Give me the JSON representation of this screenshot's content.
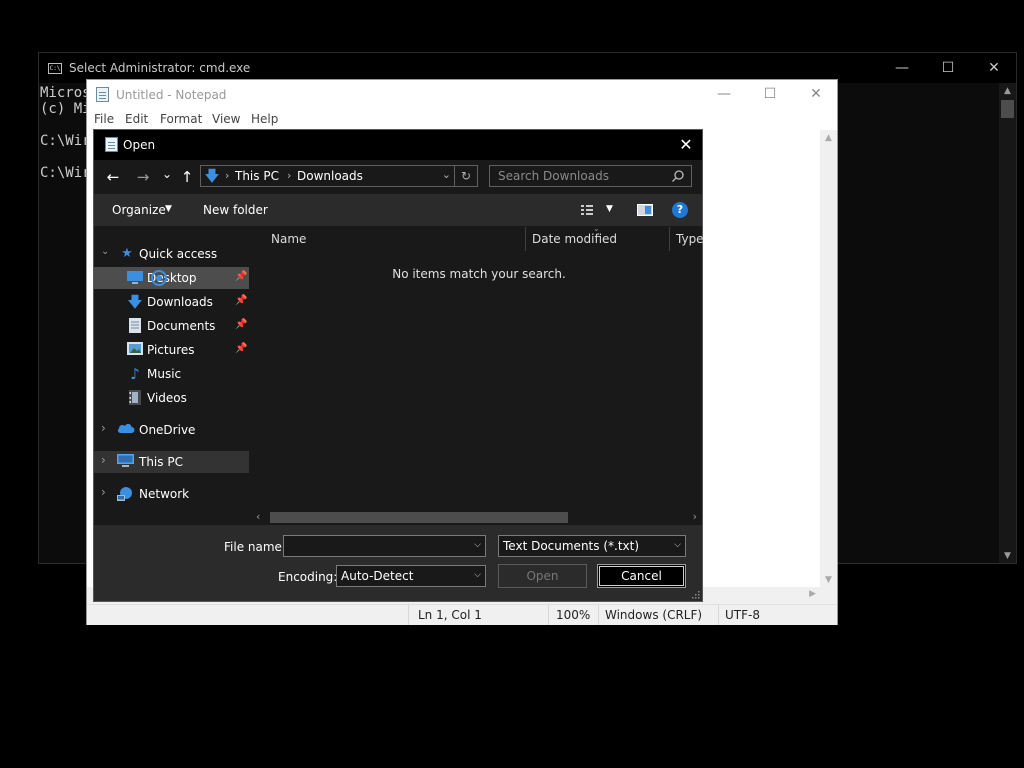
{
  "cmd": {
    "title": "Select Administrator: cmd.exe",
    "icon_text": "C:\\",
    "output": "Micros\n(c) Mi\n\nC:\\Wir\n\nC:\\Wir",
    "controls": {
      "minimize": "—",
      "maximize": "☐",
      "close": "✕"
    }
  },
  "notepad": {
    "title": "Untitled - Notepad",
    "menu": {
      "file": "File",
      "edit": "Edit",
      "format": "Format",
      "view": "View",
      "help": "Help"
    },
    "controls": {
      "minimize": "—",
      "maximize": "☐",
      "close": "✕"
    },
    "status": {
      "position": "Ln 1, Col 1",
      "zoom": "100%",
      "line_ending": "Windows (CRLF)",
      "encoding": "UTF-8"
    }
  },
  "dialog": {
    "title": "Open",
    "close": "✕",
    "nav": {
      "back": "←",
      "forward": "→",
      "recent": "⌄",
      "up": "↑"
    },
    "breadcrumb": {
      "root": "This PC",
      "current": "Downloads"
    },
    "search_placeholder": "Search Downloads",
    "toolbar": {
      "organize": "Organize",
      "new_folder": "New folder",
      "help": "?"
    },
    "tree": {
      "quick_access": "Quick access",
      "desktop": "Desktop",
      "downloads": "Downloads",
      "documents": "Documents",
      "pictures": "Pictures",
      "music": "Music",
      "videos": "Videos",
      "onedrive": "OneDrive",
      "this_pc": "This PC",
      "network": "Network"
    },
    "columns": {
      "name": "Name",
      "date_modified": "Date modified",
      "type": "Type"
    },
    "empty_message": "No items match your search.",
    "file_name_label": "File name:",
    "file_name_value": "",
    "file_type": "Text Documents (*.txt)",
    "encoding_label": "Encoding:",
    "encoding_value": "Auto-Detect",
    "open_button": "Open",
    "cancel_button": "Cancel"
  },
  "colors": {
    "accent": "#3a8fe0",
    "dialog_bg": "#2b2b2b",
    "pane_bg": "#191919",
    "selected": "#4d4d4d"
  }
}
